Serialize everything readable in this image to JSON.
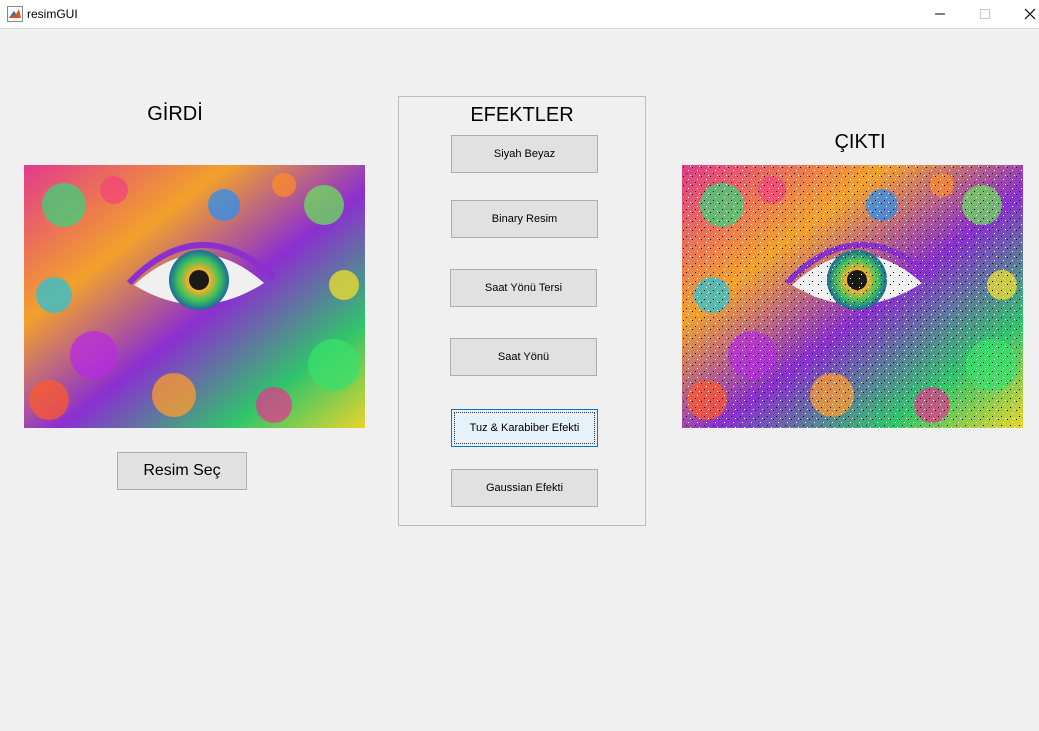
{
  "window": {
    "title": "resimGUI"
  },
  "labels": {
    "input": "GİRDİ",
    "effects": "EFEKTLER",
    "output": "ÇIKTI"
  },
  "buttons": {
    "select_image": "Resim Seç",
    "grayscale": "Siyah Beyaz",
    "binary": "Binary Resim",
    "counterclockwise": "Saat Yönü Tersi",
    "clockwise": "Saat Yönü",
    "salt_pepper": "Tuz & Karabiber Efekti",
    "gaussian": "Gaussian Efekti"
  },
  "colors": {
    "background": "#f0f0f0",
    "focus": "#0078d7"
  }
}
